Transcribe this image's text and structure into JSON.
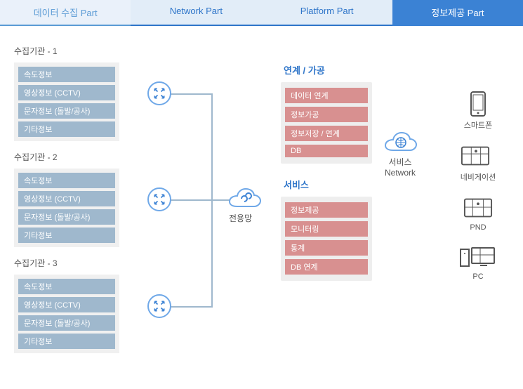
{
  "headers": {
    "data_collection": "데이터 수집 Part",
    "network": "Network Part",
    "platform": "Platform Part",
    "info_provide": "정보제공 Part"
  },
  "collection": {
    "groups": [
      {
        "title": "수집기관 - 1",
        "items": [
          "속도정보",
          "영상정보 (CCTV)",
          "문자정보 (돌발/공사)",
          "기타정보"
        ]
      },
      {
        "title": "수집기관 - 2",
        "items": [
          "속도정보",
          "영상정보 (CCTV)",
          "문자정보 (돌발/공사)",
          "기타정보"
        ]
      },
      {
        "title": "수집기관 - 3",
        "items": [
          "속도정보",
          "영상정보 (CCTV)",
          "문자정보 (돌발/공사)",
          "기타정보"
        ]
      }
    ]
  },
  "network": {
    "dedicated_label": "전용망",
    "service_label_line1": "서비스",
    "service_label_line2": "Network"
  },
  "platform": {
    "linkage_title": "연계 / 가공",
    "linkage_items": [
      "데이터 연계",
      "정보가공",
      "정보저장 / 연계",
      "DB"
    ],
    "service_title": "서비스",
    "service_items": [
      "정보제공",
      "모니터링",
      "통계",
      "DB 연계"
    ]
  },
  "devices": {
    "smartphone": "스마트폰",
    "navigation": "네비게이션",
    "pnd": "PND",
    "pc": "PC"
  },
  "icons": {
    "expand": "expand-arrows-icon",
    "link": "link-icon",
    "globe": "globe-icon"
  }
}
